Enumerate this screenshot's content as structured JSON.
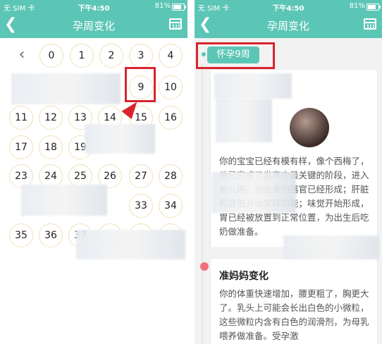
{
  "status_bar": {
    "carrier": "无 SIM 卡",
    "time": "下午4:50",
    "battery": "81%"
  },
  "nav": {
    "title": "孕周变化"
  },
  "weeks": {
    "rows": [
      [
        "0",
        "1",
        "2",
        "3",
        "4"
      ],
      [
        "",
        "",
        "",
        "9",
        "10"
      ],
      [
        "11",
        "12",
        "13",
        "14",
        "15",
        "16"
      ],
      [
        "17",
        "18",
        "19",
        "",
        "",
        ""
      ],
      [
        "23",
        "24",
        "25",
        "26",
        "27",
        "28"
      ],
      [
        "",
        "",
        "",
        "",
        "33",
        "34"
      ],
      [
        "35",
        "36",
        "37",
        "",
        "",
        ""
      ]
    ]
  },
  "detail": {
    "week_label": "怀孕9周",
    "baby_text": "你的宝宝已经有模有样，像个西梅了，他已完成了发育中最关键的阶段，进入胎儿期。他全身的器官已经形成；肝脏和肾脏开始发挥功能；味觉开始形成，胃已经被放置到正常位置，为出生后吃奶做准备。",
    "mom_title": "准妈妈变化",
    "mom_text": "你的体重快速增加，腰更粗了，胸更大了。乳头上可能会长出白色的小微粒，这些微粒内含有白色的润滑剂，为母乳喂养做准备。受孕激"
  }
}
